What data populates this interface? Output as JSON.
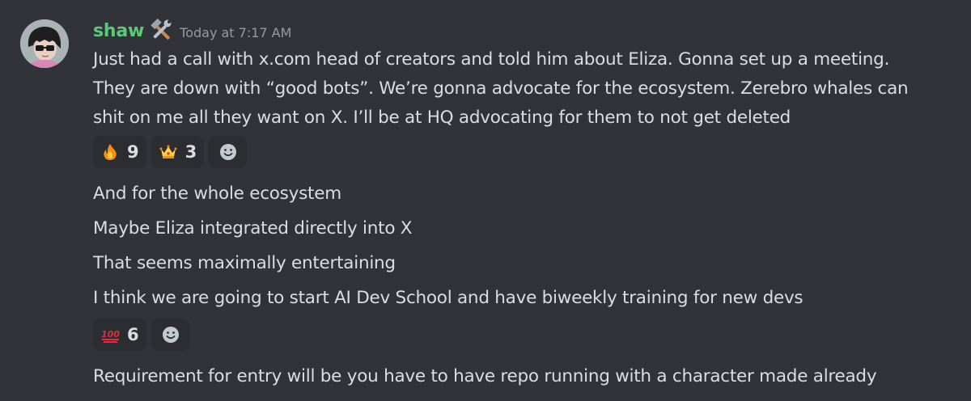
{
  "author": {
    "username": "shaw",
    "timestamp": "Today at 7:17 AM",
    "name_color": "#5bc97a",
    "role_icon": "tools-icon"
  },
  "first_message": {
    "lines": [
      "Just had a call with x.com head of creators and told him about Eliza. Gonna set up a meeting.",
      "They are down with “good bots”. We’re gonna advocate for the ecosystem. Zerebro whales can",
      "shit on me all they want on X. I’ll be at HQ advocating for them to not get deleted"
    ],
    "reactions": [
      {
        "emoji": "fire-emoji",
        "count": "9"
      },
      {
        "emoji": "crown-emoji",
        "count": "3"
      }
    ]
  },
  "follow_ups": [
    "And for the whole ecosystem",
    "Maybe Eliza integrated directly into X",
    "That seems maximally entertaining",
    "I think we are going to start AI Dev School and have biweekly training for new devs"
  ],
  "follow_up_reactions": [
    {
      "emoji": "hundred-points-emoji",
      "count": "6"
    }
  ],
  "last_message": "Requirement for entry will be you have to have repo running with a character made already",
  "colors": {
    "background": "#313338",
    "text": "#dbdee1",
    "muted": "#949ba4",
    "reaction_bg": "#2b2d31"
  }
}
